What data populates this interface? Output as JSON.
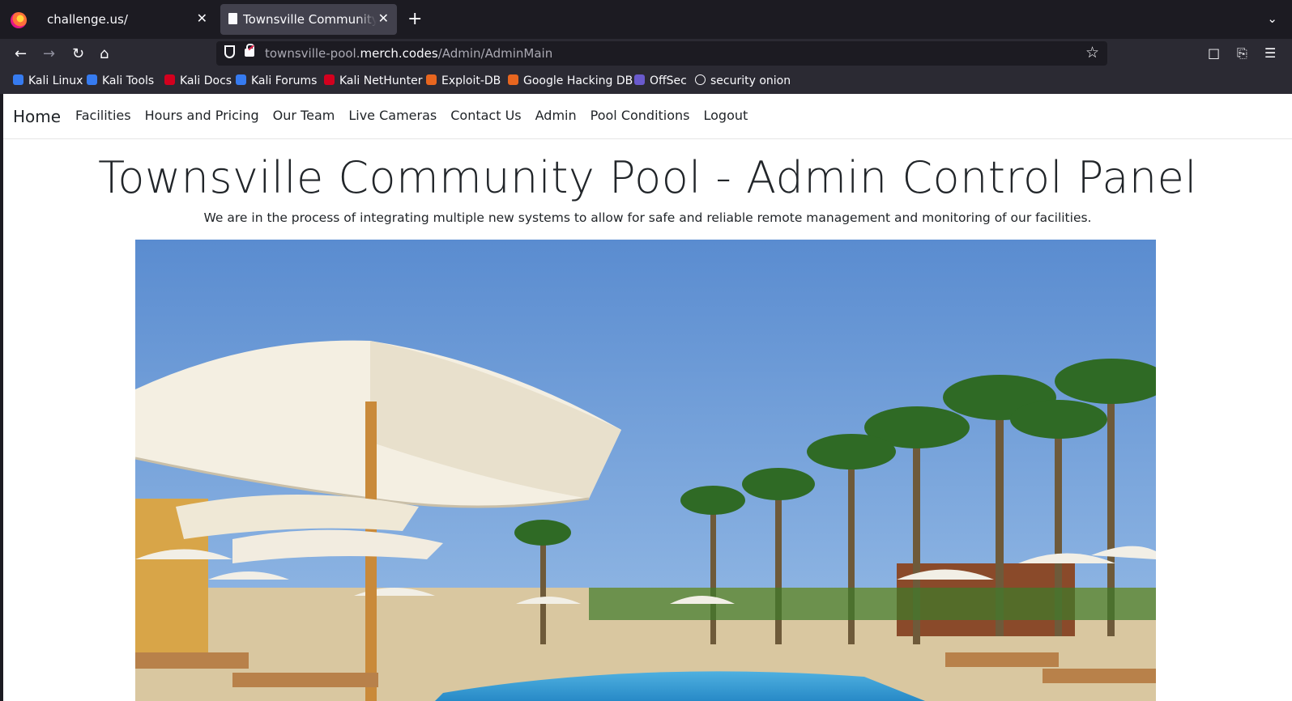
{
  "browser": {
    "tabs": [
      {
        "title": "challenge.us/",
        "close": "✕"
      },
      {
        "title": "Townsville Community Pool",
        "close": "✕"
      }
    ],
    "new_tab": "+",
    "tab_list": "⌄",
    "url_prefix": "townsville-pool.",
    "url_domain": "merch.codes",
    "url_path": "/Admin/AdminMain",
    "bookmarks": [
      {
        "label": "Kali Linux",
        "color": "#367bf0"
      },
      {
        "label": "Kali Tools",
        "color": "#367bf0"
      },
      {
        "label": "Kali Docs",
        "color": "#d3001e"
      },
      {
        "label": "Kali Forums",
        "color": "#367bf0"
      },
      {
        "label": "Kali NetHunter",
        "color": "#d3001e"
      },
      {
        "label": "Exploit-DB",
        "color": "#e8661f"
      },
      {
        "label": "Google Hacking DB",
        "color": "#e8661f"
      },
      {
        "label": "OffSec",
        "color": "#6a5acd"
      },
      {
        "label": "security onion",
        "color": "#aaaaaa"
      }
    ]
  },
  "site": {
    "brand": "Home",
    "nav": [
      "Facilities",
      "Hours and Pricing",
      "Our Team",
      "Live Cameras",
      "Contact Us",
      "Admin",
      "Pool Conditions",
      "Logout"
    ],
    "title": "Townsville Community Pool - Admin Control Panel",
    "subtitle": "We are in the process of integrating multiple new systems to allow for safe and reliable remote management and monitoring of our facilities."
  }
}
